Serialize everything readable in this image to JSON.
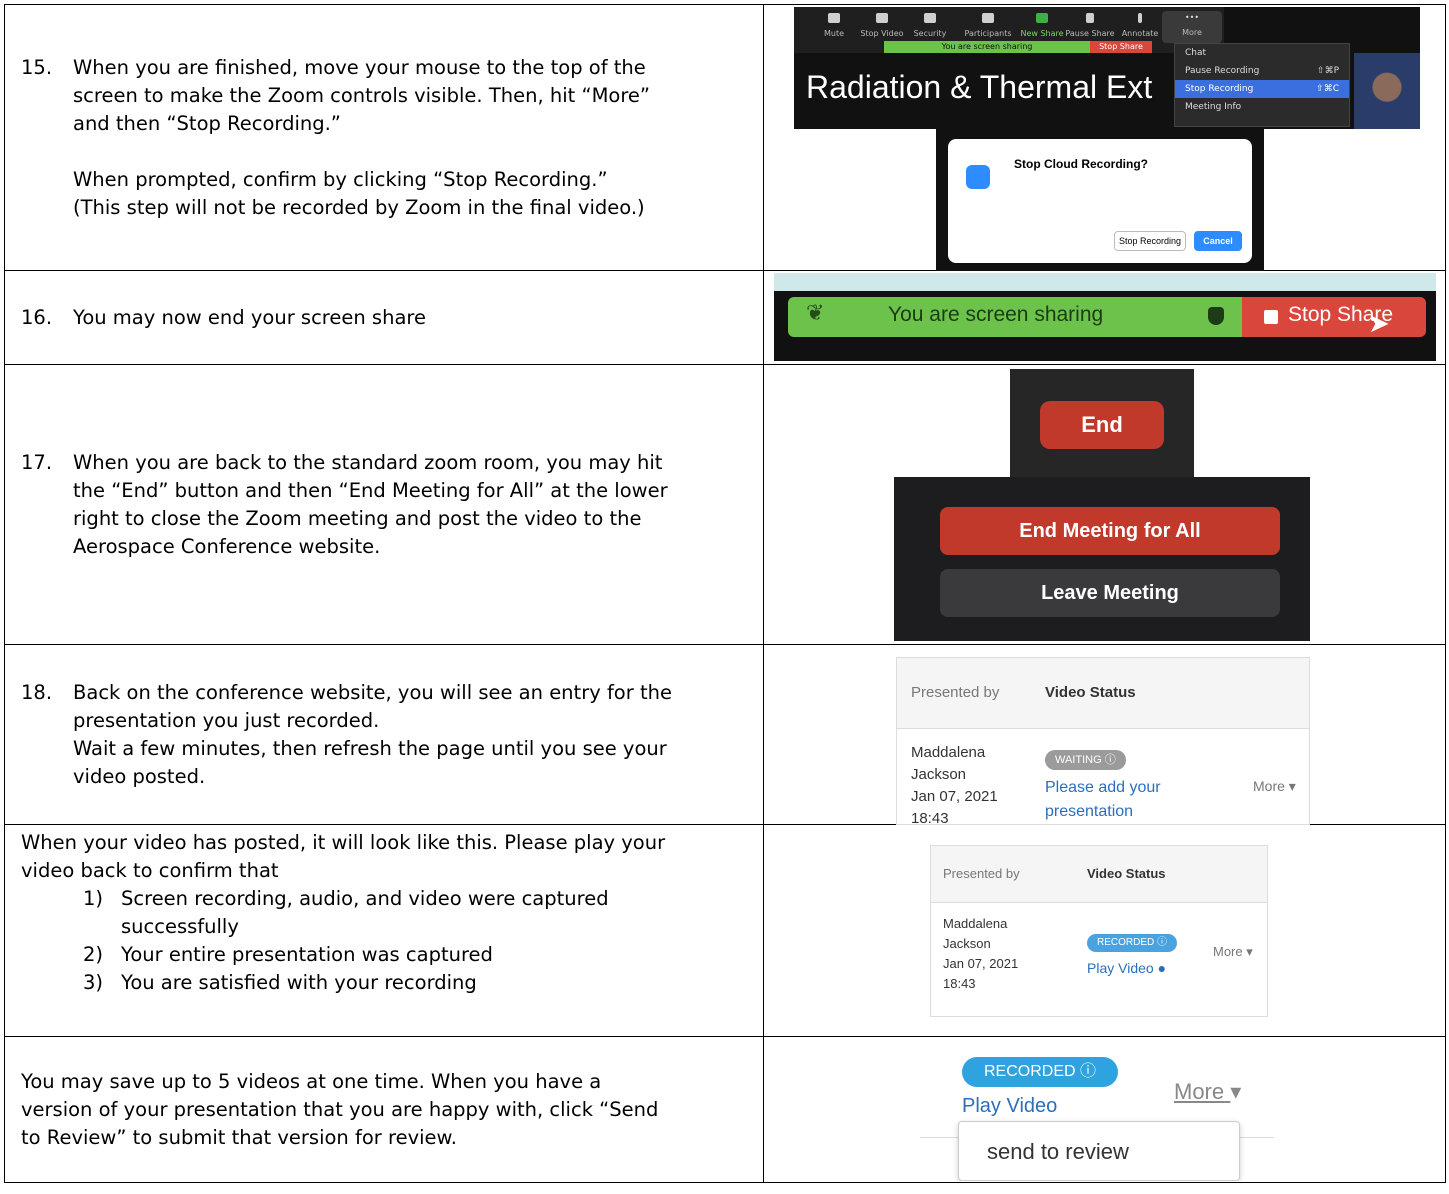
{
  "rows": [
    {
      "number": "15.",
      "lines": [
        "When you are finished, move your mouse to the top of the",
        "screen to make the Zoom controls visible. Then, hit “More”",
        "and then “Stop Recording.”"
      ],
      "lines2": [
        "When prompted, confirm by clicking “Stop Recording.”",
        "(This step will not be recorded by Zoom in the final video.)"
      ]
    },
    {
      "number": "16.",
      "lines": [
        "You may now end your screen share"
      ]
    },
    {
      "number": "17.",
      "lines": [
        "When you are back to the standard zoom room, you may hit",
        "the “End” button and then “End Meeting for All” at the lower",
        "right to close the Zoom meeting and post the video to the",
        "Aerospace Conference website."
      ]
    },
    {
      "number": "18.",
      "lines": [
        "Back on the conference website, you will see an entry for the",
        "presentation you just recorded.",
        "Wait a few minutes, then refresh the page until you see your",
        "video posted."
      ]
    },
    {
      "intro": [
        "When your video has posted, it will look like this. Please play your",
        "video back to confirm that"
      ],
      "items": [
        {
          "n": "1)",
          "lines": [
            "Screen recording, audio, and video were captured",
            "successfully"
          ]
        },
        {
          "n": "2)",
          "lines": [
            "Your entire presentation was captured"
          ]
        },
        {
          "n": "3)",
          "lines": [
            "You are satisfied with your recording"
          ]
        }
      ]
    },
    {
      "lines": [
        "You may save up to 5 videos at one time.  When you have a",
        "version of your presentation that you are happy with, click “Send",
        "to Review” to submit that version for review."
      ]
    }
  ],
  "zoom_toolbar": {
    "items": [
      "Mute",
      "Stop Video",
      "Security",
      "Participants",
      "New Share",
      "Pause Share",
      "Annotate",
      "More"
    ],
    "sharing_text": "You are screen sharing",
    "stop_share": "Stop Share",
    "slide_title": "Radiation & Thermal Ext",
    "menu": [
      "Chat",
      "Pause Recording",
      "Stop Recording",
      "Meeting Info"
    ],
    "menu_shortcuts": [
      "",
      "⇧⌘P",
      "⇧⌘C",
      ""
    ]
  },
  "stop_dialog": {
    "title": "Stop Cloud Recording?",
    "stop_btn": "Stop Recording",
    "cancel_btn": "Cancel"
  },
  "share_bar": {
    "text": "You are screen sharing",
    "stop": "Stop Share"
  },
  "end_panel": {
    "end_btn": "End",
    "end_all": "End Meeting for All",
    "leave": "Leave Meeting"
  },
  "lms_waiting": {
    "col1": "Presented by",
    "col2": "Video Status",
    "name1": "Maddalena",
    "name2": "Jackson",
    "date": "Jan 07, 2021",
    "time": "18:43",
    "badge": "WAITING ⓘ",
    "link1": "Please add your",
    "link2": "presentation",
    "more": "More ▾"
  },
  "lms_recorded": {
    "col1": "Presented by",
    "col2": "Video Status",
    "name1": "Maddalena",
    "name2": "Jackson",
    "date": "Jan 07, 2021",
    "time": "18:43",
    "badge": "RECORDED ⓘ",
    "link": "Play Video",
    "more": "More ▾"
  },
  "review_panel": {
    "badge": "RECORDED ⓘ",
    "link": "Play Video",
    "more": "More",
    "dropdown": "send to review"
  },
  "colors": {
    "zoom_green": "#6cc24a",
    "zoom_red": "#d9473c",
    "end_red": "#c0392b",
    "zoom_blue": "#2d8cff",
    "waiting_grey": "#9b9b9b",
    "recorded_blue": "#4aa3df",
    "link_blue": "#2a6fbd"
  }
}
